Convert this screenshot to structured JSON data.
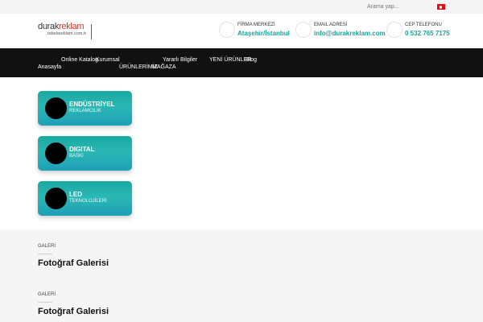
{
  "topbar": {
    "search_placeholder": "Arama yap...",
    "language_flag": "tr-flag-icon"
  },
  "header": {
    "logo": {
      "line1_a": "durak",
      "line1_b": "reklam",
      "line2": "tabelareklam.com.tr"
    },
    "address": {
      "label": "FİRMA MERKEZİ",
      "value": "Ataşehir/İstanbul",
      "icon": "location-icon"
    },
    "email": {
      "label": "EMAIL ADRESİ",
      "value": "info@durakreklam.com",
      "icon": "mail-icon"
    },
    "phone": {
      "label": "CEP TELEFONU",
      "value": "0 532 765 7175",
      "icon": "phone-icon"
    },
    "accent_color": "#1aa39a"
  },
  "nav": {
    "items": [
      "Online Katalog",
      "Kurumsal",
      "Yararlı Bilgiler",
      "YENİ ÜRÜNLER",
      "Blog",
      "Anasayfa",
      "ÜRÜNLERİMİZ",
      "MAĞAZA"
    ]
  },
  "services": [
    {
      "title": "ENDÜSTRİYEL",
      "subtitle": "REKLAMCILIK"
    },
    {
      "title": "DIGITAL",
      "subtitle": "BASKI"
    },
    {
      "title": "LED",
      "subtitle": "TEKNOLOJİLERİ"
    }
  ],
  "gallery": [
    {
      "label": "GALERİ",
      "title": "Fotoğraf Galerisi"
    },
    {
      "label": "GALERİ",
      "title": "Fotoğraf Galerisi"
    }
  ]
}
